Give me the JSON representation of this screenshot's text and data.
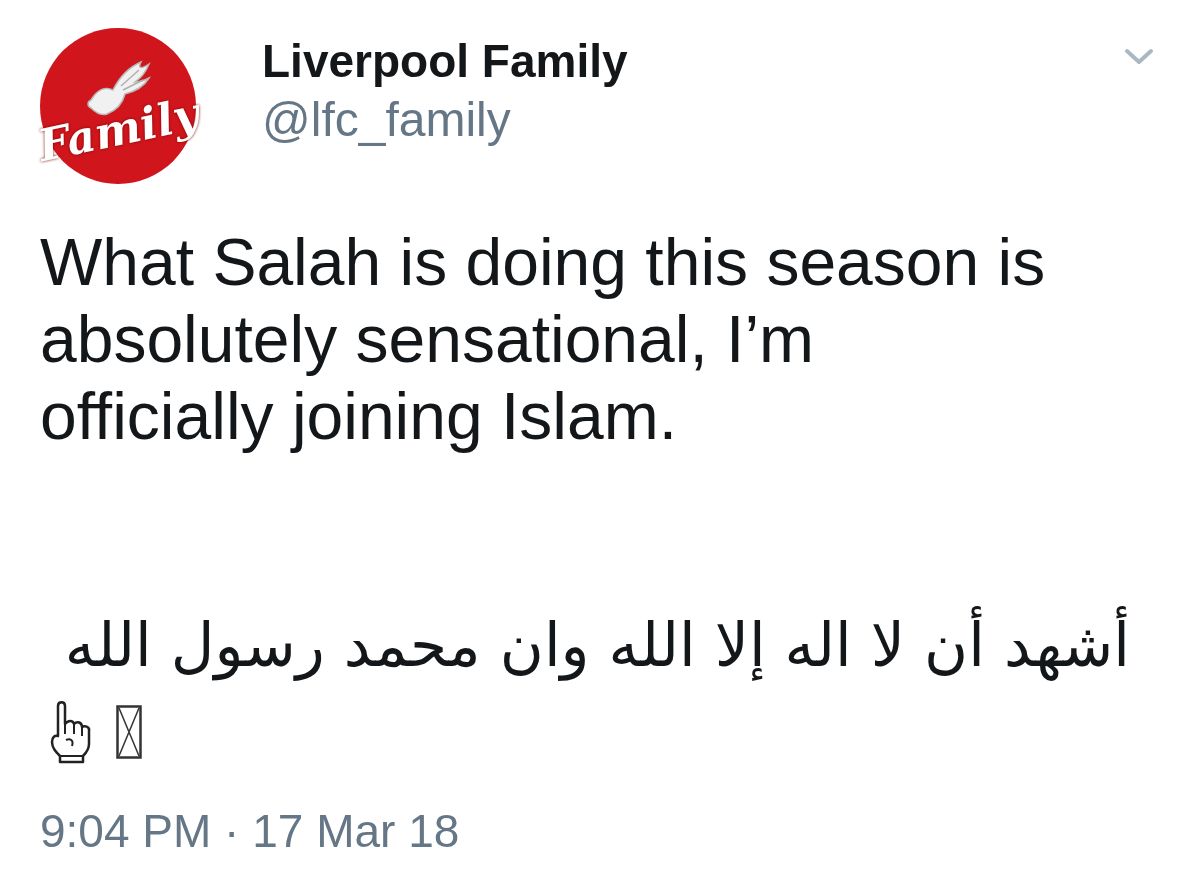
{
  "account": {
    "logo_text": "Family",
    "name": "Liverpool Family",
    "handle": "@lfc_family"
  },
  "tweet": {
    "paragraphs": [
      "What Salah is doing this season is absolutely sensational, I’m officially joining Islam.",
      "أشهد أن لا اله إلا الله وان محمد رسول الله"
    ],
    "timestamp": "9:04 PM · 17 Mar 18"
  }
}
